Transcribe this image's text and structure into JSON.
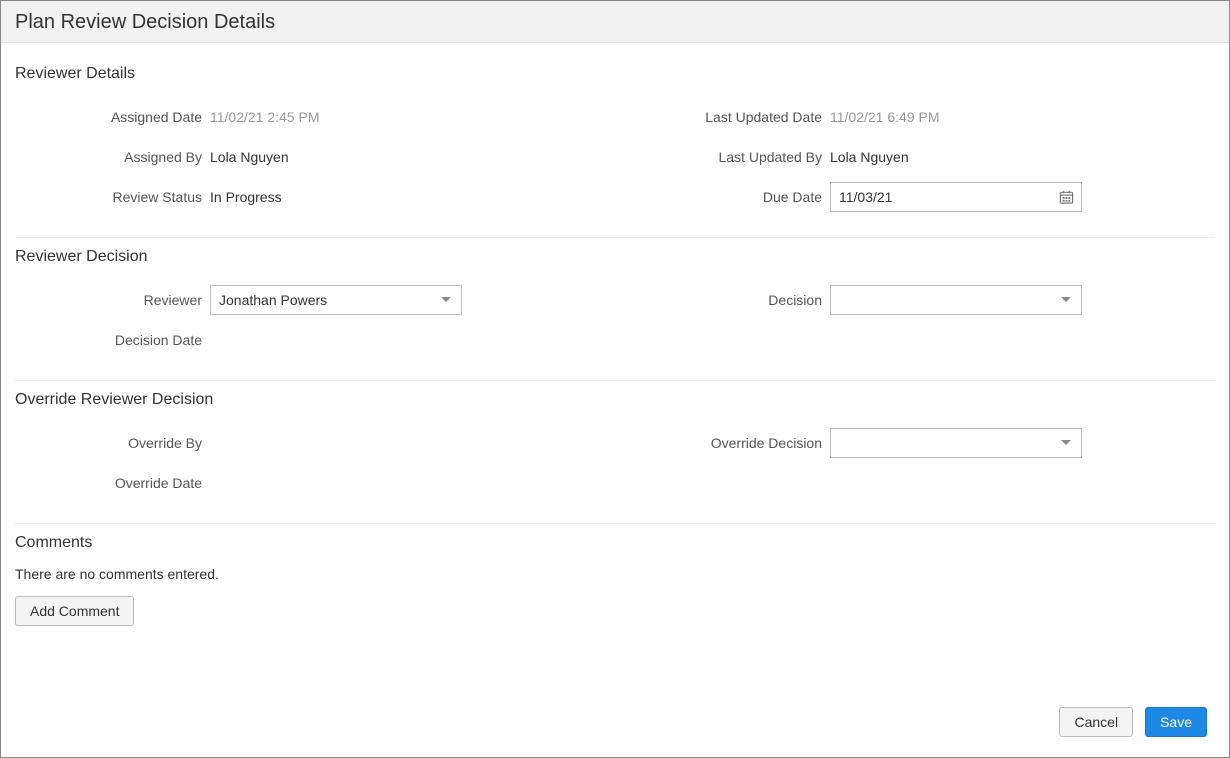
{
  "header": {
    "title": "Plan Review Decision Details"
  },
  "reviewer_details": {
    "title": "Reviewer Details",
    "labels": {
      "assigned_date": "Assigned Date",
      "assigned_by": "Assigned By",
      "review_status": "Review Status",
      "last_updated_date": "Last Updated Date",
      "last_updated_by": "Last Updated By",
      "due_date": "Due Date"
    },
    "values": {
      "assigned_date": "11/02/21 2:45 PM",
      "assigned_by": "Lola Nguyen",
      "review_status": "In Progress",
      "last_updated_date": "11/02/21 6:49 PM",
      "last_updated_by": "Lola Nguyen",
      "due_date": "11/03/21"
    }
  },
  "reviewer_decision": {
    "title": "Reviewer Decision",
    "labels": {
      "reviewer": "Reviewer",
      "decision_date": "Decision Date",
      "decision": "Decision"
    },
    "values": {
      "reviewer": "Jonathan Powers",
      "decision_date": "",
      "decision": ""
    }
  },
  "override": {
    "title": "Override Reviewer Decision",
    "labels": {
      "override_by": "Override By",
      "override_date": "Override Date",
      "override_decision": "Override Decision"
    },
    "values": {
      "override_by": "",
      "override_date": "",
      "override_decision": ""
    }
  },
  "comments": {
    "title": "Comments",
    "empty_text": "There are no comments entered.",
    "add_label": "Add Comment"
  },
  "footer": {
    "cancel": "Cancel",
    "save": "Save"
  }
}
